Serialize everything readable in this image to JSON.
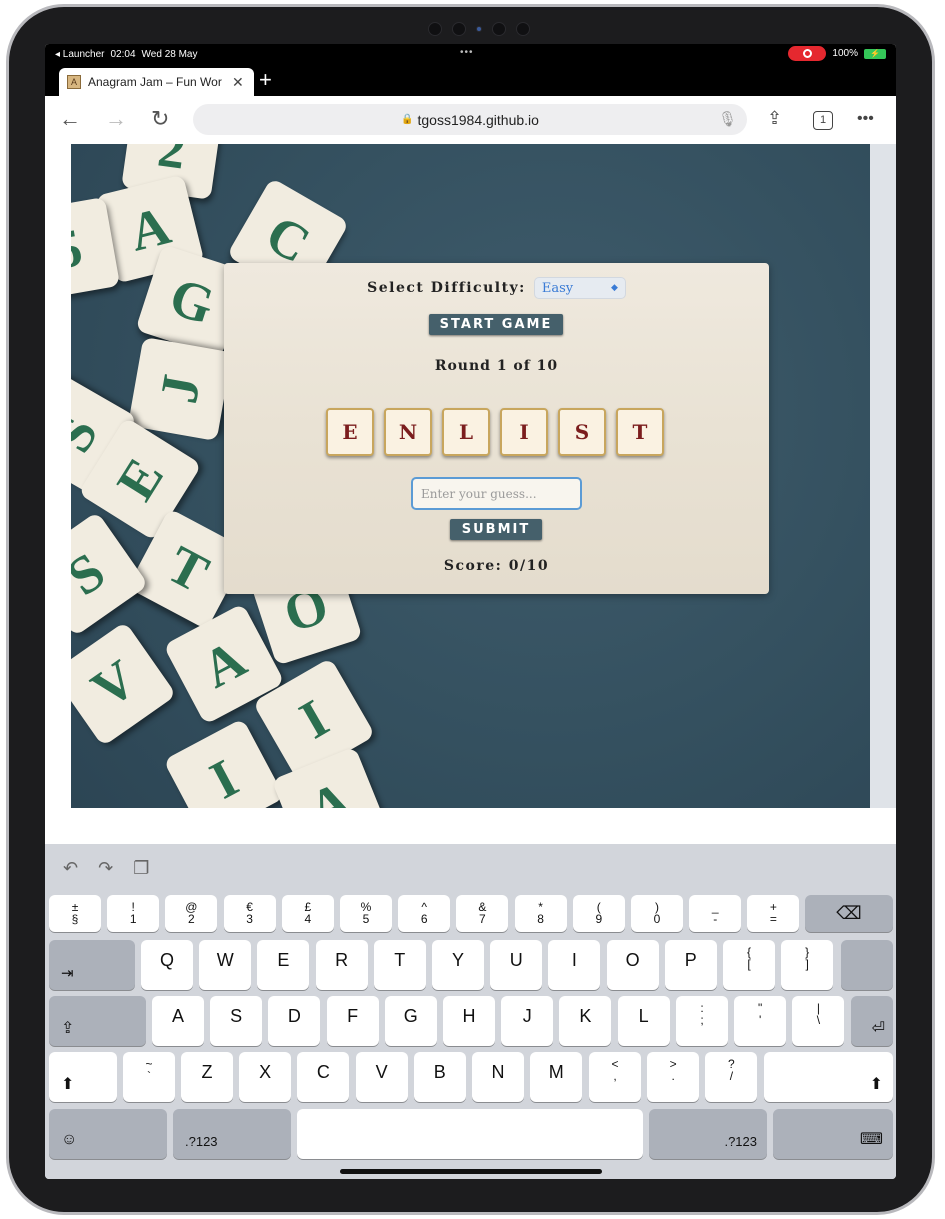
{
  "status": {
    "app_back": "◂ Launcher",
    "time": "02:04",
    "date": "Wed 28 May",
    "dots": "•••",
    "battery_pct": "100%"
  },
  "browser": {
    "tab_title": "Anagram Jam – Fun Wor",
    "favicon": "A",
    "url": "tgoss1984.github.io",
    "tab_count": "1"
  },
  "game": {
    "difficulty_label": "Select Difficulty:",
    "difficulty_value": "Easy",
    "start_label": "START GAME",
    "round_text": "Round 1 of 10",
    "tiles": [
      "E",
      "N",
      "L",
      "I",
      "S",
      "T"
    ],
    "guess_placeholder": "Enter your guess...",
    "submit_label": "SUBMIT",
    "score_text": "Score: 0/10"
  },
  "background_tiles": [
    "2",
    "A",
    "C",
    "G",
    "5",
    "J",
    "S",
    "E",
    "T",
    "S",
    "A",
    "V",
    "I",
    "I",
    "O",
    "A"
  ],
  "keyboard": {
    "num_row": [
      [
        "±",
        "§"
      ],
      [
        "!",
        "1"
      ],
      [
        "@",
        "2"
      ],
      [
        "€",
        "3"
      ],
      [
        "£",
        "4"
      ],
      [
        "%",
        "5"
      ],
      [
        "^",
        "6"
      ],
      [
        "&",
        "7"
      ],
      [
        "*",
        "8"
      ],
      [
        "(",
        "9"
      ],
      [
        ")",
        "0"
      ],
      [
        "_",
        "-"
      ],
      [
        "+",
        "="
      ]
    ],
    "row_q": [
      "Q",
      "W",
      "E",
      "R",
      "T",
      "Y",
      "U",
      "I",
      "O",
      "P"
    ],
    "row_q_extra": [
      [
        "{",
        "["
      ],
      [
        "}",
        "]"
      ]
    ],
    "row_a": [
      "A",
      "S",
      "D",
      "F",
      "G",
      "H",
      "J",
      "K",
      "L"
    ],
    "row_a_extra": [
      [
        ":",
        ";"
      ],
      [
        "\"",
        "'"
      ],
      [
        "|",
        "\\"
      ]
    ],
    "row_z": [
      "Z",
      "X",
      "C",
      "V",
      "B",
      "N",
      "M"
    ],
    "row_z_extra": [
      [
        "~",
        "`"
      ],
      [
        "<",
        ","
      ],
      [
        ">",
        "."
      ],
      [
        "?",
        "/"
      ]
    ],
    "mode_key": ".?123"
  }
}
